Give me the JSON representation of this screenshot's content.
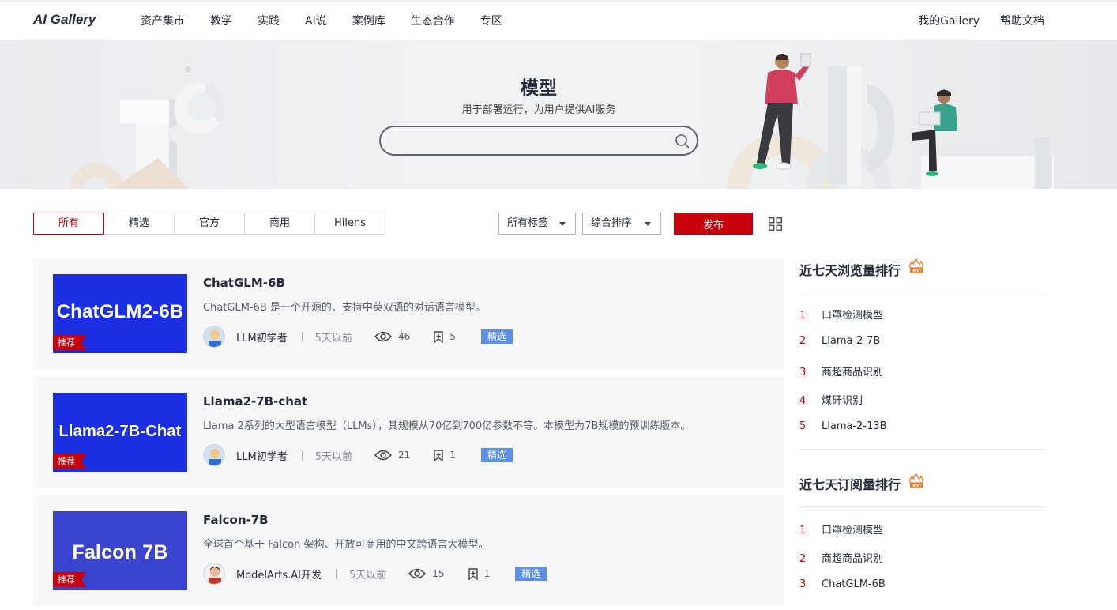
{
  "header": {
    "logo": "AI Gallery",
    "nav": [
      "资产集市",
      "教学",
      "实践",
      "AI说",
      "案例库",
      "生态合作",
      "专区"
    ],
    "nav_right": [
      "我的Gallery",
      "帮助文档"
    ]
  },
  "banner": {
    "title": "模型",
    "subtitle": "用于部署运行，为用户提供AI服务",
    "search_placeholder": "",
    "search_value": ""
  },
  "filters": {
    "tabs": [
      "所有",
      "精选",
      "官方",
      "商用",
      "Hilens"
    ],
    "active_tab": "所有",
    "tag_select": "所有标签",
    "sort_select": "综合排序",
    "publish_label": "发布"
  },
  "cards": [
    {
      "thumb_text": "ChatGLM2-6B",
      "thumb_color": "#1c2fe0",
      "ribbon": "推荐",
      "title": "ChatGLM-6B",
      "desc": "ChatGLM-6B 是一个开源的、支持中英双语的对话语言模型。",
      "author": "LLM初学者",
      "time": "5天以前",
      "views": "46",
      "bookmarks": "5",
      "badge": "精选"
    },
    {
      "thumb_text": "Llama2-7B-Chat",
      "thumb_color": "#1c2fe0",
      "ribbon": "推荐",
      "title": "Llama2-7B-chat",
      "desc": "Llama 2系列的大型语言模型（LLMs），其规模从70亿到700亿参数不等。本模型为7B规模的预训练版本。",
      "author": "LLM初学者",
      "time": "5天以前",
      "views": "21",
      "bookmarks": "1",
      "badge": "精选"
    },
    {
      "thumb_text": "Falcon 7B",
      "thumb_color": "#3b44cf",
      "ribbon": "推荐",
      "title": "Falcon-7B",
      "desc": "全球首个基于 Falcon 架构、开放可商用的中文跨语言大模型。",
      "author": "ModelArts.AI开发",
      "time": "5天以前",
      "views": "15",
      "bookmarks": "1",
      "badge": "精选"
    }
  ],
  "sidebar": {
    "views_title": "近七天浏览量排行",
    "views_ranking": [
      {
        "rank": "1",
        "name": "口罩检测模型"
      },
      {
        "rank": "2",
        "name": "Llama-2-7B"
      },
      {
        "rank": "3",
        "name": "商超商品识别"
      },
      {
        "rank": "4",
        "name": "煤矸识别"
      },
      {
        "rank": "5",
        "name": "Llama-2-13B"
      }
    ],
    "subs_title": "近七天订阅量排行",
    "subs_ranking": [
      {
        "rank": "1",
        "name": "口罩检测模型"
      },
      {
        "rank": "2",
        "name": "商超商品识别"
      },
      {
        "rank": "3",
        "name": "ChatGLM-6B"
      }
    ]
  },
  "colors": {
    "brand_red": "#c7000b",
    "badge_blue": "#5e8fe8"
  }
}
